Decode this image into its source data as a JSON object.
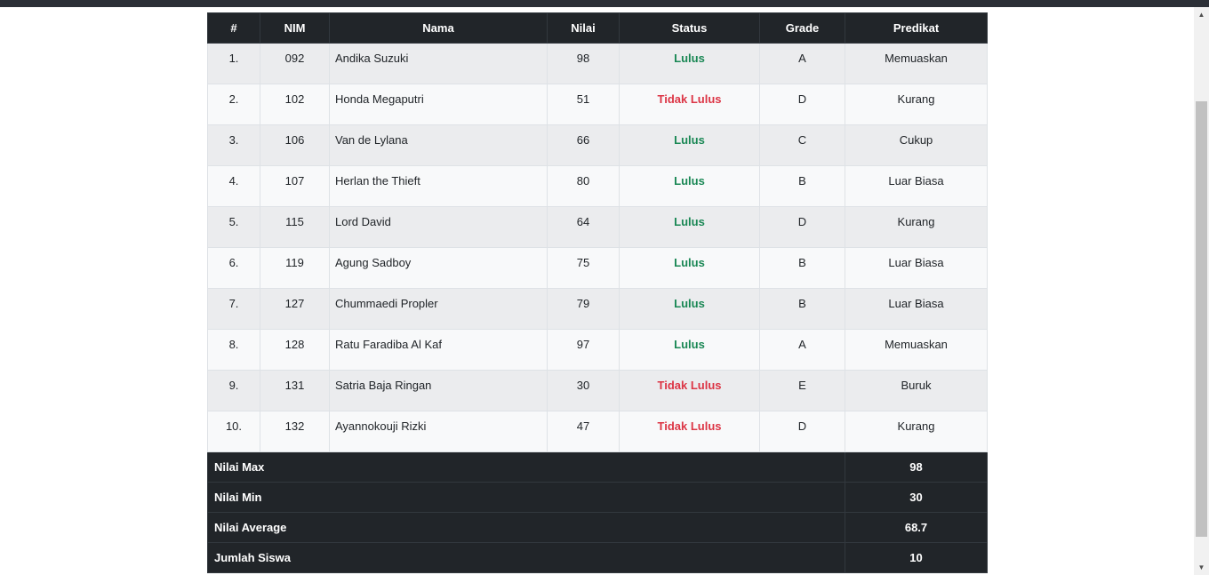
{
  "table": {
    "headers": [
      "#",
      "NIM",
      "Nama",
      "Nilai",
      "Status",
      "Grade",
      "Predikat"
    ],
    "rows": [
      {
        "no": "1.",
        "nim": "092",
        "nama": "Andika Suzuki",
        "nilai": "98",
        "status": "Lulus",
        "grade": "A",
        "predikat": "Memuaskan"
      },
      {
        "no": "2.",
        "nim": "102",
        "nama": "Honda Megaputri",
        "nilai": "51",
        "status": "Tidak Lulus",
        "grade": "D",
        "predikat": "Kurang"
      },
      {
        "no": "3.",
        "nim": "106",
        "nama": "Van de Lylana",
        "nilai": "66",
        "status": "Lulus",
        "grade": "C",
        "predikat": "Cukup"
      },
      {
        "no": "4.",
        "nim": "107",
        "nama": "Herlan the Thieft",
        "nilai": "80",
        "status": "Lulus",
        "grade": "B",
        "predikat": "Luar Biasa"
      },
      {
        "no": "5.",
        "nim": "115",
        "nama": "Lord David",
        "nilai": "64",
        "status": "Lulus",
        "grade": "D",
        "predikat": "Kurang"
      },
      {
        "no": "6.",
        "nim": "119",
        "nama": "Agung Sadboy",
        "nilai": "75",
        "status": "Lulus",
        "grade": "B",
        "predikat": "Luar Biasa"
      },
      {
        "no": "7.",
        "nim": "127",
        "nama": "Chummaedi Propler",
        "nilai": "79",
        "status": "Lulus",
        "grade": "B",
        "predikat": "Luar Biasa"
      },
      {
        "no": "8.",
        "nim": "128",
        "nama": "Ratu Faradiba Al Kaf",
        "nilai": "97",
        "status": "Lulus",
        "grade": "A",
        "predikat": "Memuaskan"
      },
      {
        "no": "9.",
        "nim": "131",
        "nama": "Satria Baja Ringan",
        "nilai": "30",
        "status": "Tidak Lulus",
        "grade": "E",
        "predikat": "Buruk"
      },
      {
        "no": "10.",
        "nim": "132",
        "nama": "Ayannokouji Rizki",
        "nilai": "47",
        "status": "Tidak Lulus",
        "grade": "D",
        "predikat": "Kurang"
      }
    ]
  },
  "summary": [
    {
      "label": "Nilai Max",
      "value": "98"
    },
    {
      "label": "Nilai Min",
      "value": "30"
    },
    {
      "label": "Nilai Average",
      "value": "68.7"
    },
    {
      "label": "Jumlah Siswa",
      "value": "10"
    }
  ],
  "colors": {
    "header_bg": "#212529",
    "status_pass": "#198754",
    "status_fail": "#dc3545"
  },
  "icons": {
    "scroll_up": "scroll-up-arrow-icon",
    "scroll_down": "scroll-down-arrow-icon"
  }
}
